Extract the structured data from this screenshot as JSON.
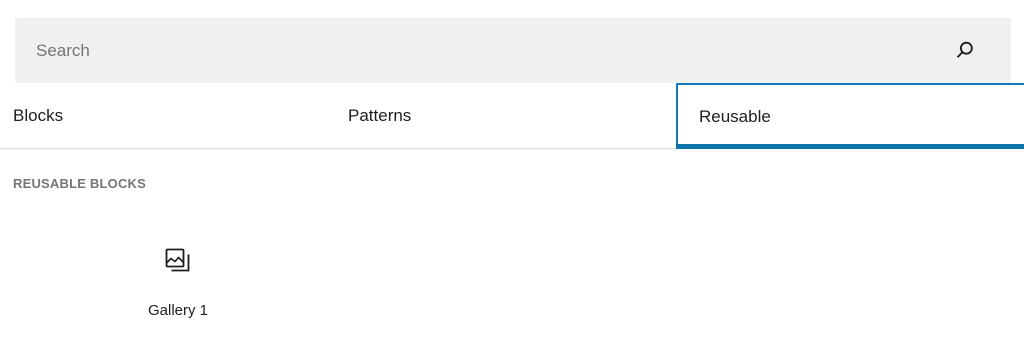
{
  "search": {
    "placeholder": "Search",
    "value": "",
    "icon": "search-icon"
  },
  "tabs": [
    {
      "label": "Blocks",
      "selected": false
    },
    {
      "label": "Patterns",
      "selected": false
    },
    {
      "label": "Reusable",
      "selected": true
    }
  ],
  "section": {
    "title": "REUSABLE BLOCKS"
  },
  "blocks": [
    {
      "label": "Gallery 1",
      "icon": "gallery-icon"
    }
  ],
  "colors": {
    "accent": "#0f75a8",
    "search_bg": "#f0f0f0",
    "muted_text": "#757575"
  }
}
